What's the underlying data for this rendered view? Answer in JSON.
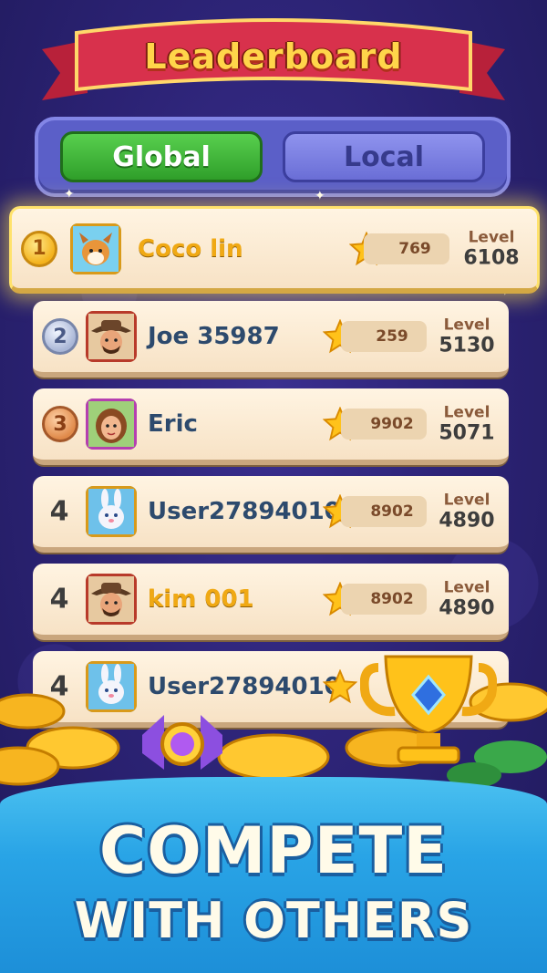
{
  "header": {
    "title": "Leaderboard"
  },
  "tabs": {
    "global": "Global",
    "local": "Local",
    "active": "Global"
  },
  "leaderboard": {
    "level_label": "Level",
    "rows": [
      {
        "rank": "1",
        "name": "Coco lin",
        "score": "769",
        "level": "6108",
        "avatar": "dog-avatar"
      },
      {
        "rank": "2",
        "name": "Joe 35987",
        "score": "259",
        "level": "5130",
        "avatar": "cowboy-avatar"
      },
      {
        "rank": "3",
        "name": "Eric",
        "score": "9902",
        "level": "5071",
        "avatar": "girl-avatar"
      },
      {
        "rank": "4",
        "name": "User27894010",
        "score": "8902",
        "level": "4890",
        "avatar": "bunny-avatar"
      },
      {
        "rank": "4",
        "name": "kim 001",
        "score": "8902",
        "level": "4890",
        "avatar": "cowboy-avatar"
      },
      {
        "rank": "4",
        "name": "User27894010",
        "score": "",
        "level": "",
        "avatar": "bunny-avatar"
      }
    ]
  },
  "promo": {
    "line1": "COMPETE",
    "line2": "WITH OTHERS"
  },
  "colors": {
    "background": "#2b2273",
    "gold": "#f0a914",
    "green_tab": "#3fb838",
    "blue_panel": "#29a4e6"
  }
}
